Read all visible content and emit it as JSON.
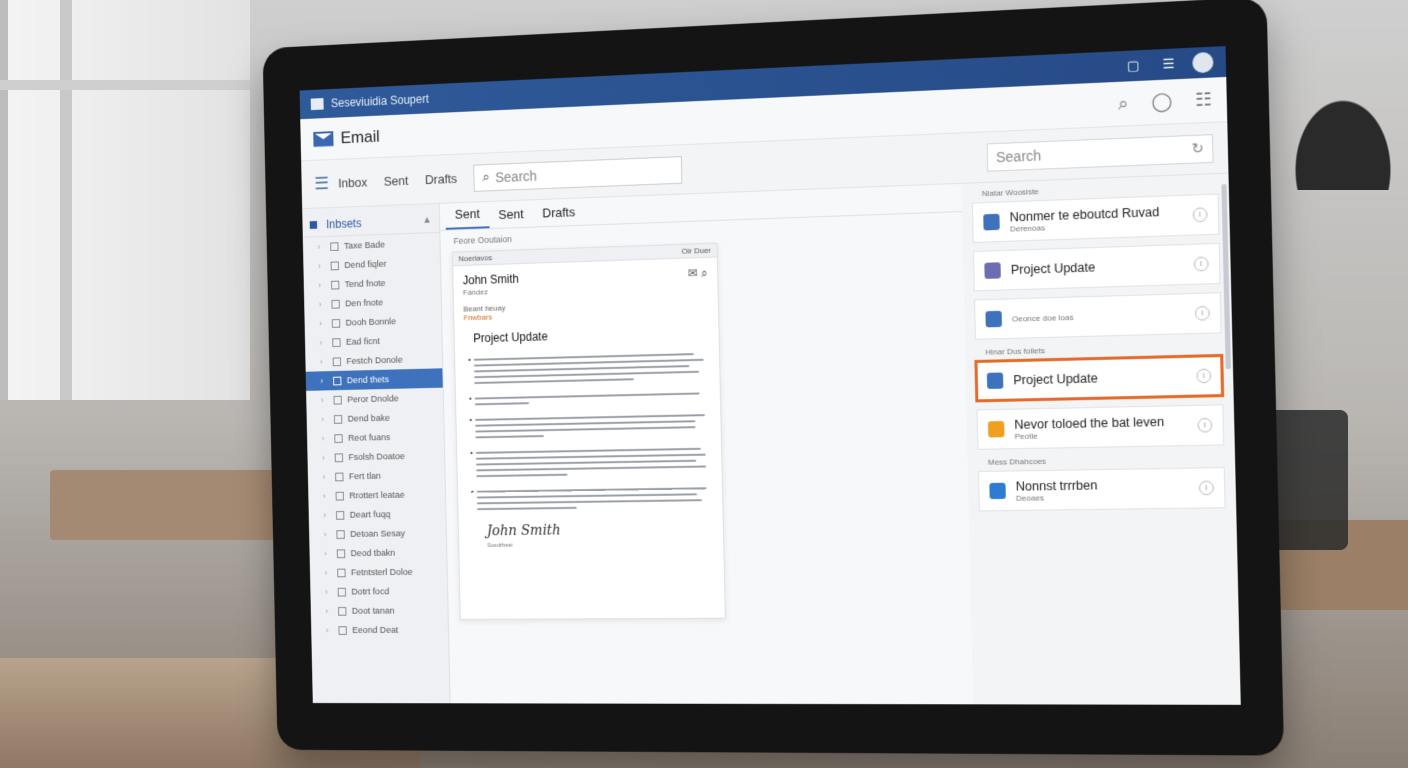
{
  "window": {
    "title": "Seseviuidia Soupert"
  },
  "app": {
    "title": "Email"
  },
  "toolbar": {
    "nav": [
      "Inbox",
      "Sent",
      "Drafts"
    ],
    "search_placeholder": "Search",
    "search2_placeholder": "Search"
  },
  "sidebar": {
    "header": "Inbsets",
    "items": [
      "Taxe Bade",
      "Dend fiqler",
      "Tend fnote",
      "Den fnote",
      "Dooh Bonnle",
      "Ead ficnt",
      "Festch Donole",
      "Dend thets",
      "Peror Dnolde",
      "Dend bake",
      "Reot fuans",
      "Fsolsh Doatoe",
      "Fert tlan",
      "Rrottert leatae",
      "Deart fuqq",
      "Detoan Sesay",
      "Deod tbakn",
      "Fetntsterl Doloe",
      "Dotrt focd",
      "Doot tanan",
      "Eeond Deat"
    ],
    "active_index": 7
  },
  "tabs": [
    "Sent",
    "Sent",
    "Drafts"
  ],
  "center": {
    "sublabel": "Feore Ooutaion",
    "message": {
      "topbar_left": "Noerlavos",
      "topbar_right": "Oir Duer",
      "from": "John Smith",
      "from_sub": "Fandez",
      "label1": "Beant heuay",
      "label2": "Fnwbars",
      "subject": "Project Update",
      "signature": "John Smith",
      "signature_sub": "Soedrbsai"
    }
  },
  "right": {
    "top_label": "Nlatar Woosiste",
    "cards": [
      {
        "title": "Nonmer te eboutcd Ruvad",
        "sub": "Derenoas",
        "icon_color": "#3e72bd"
      },
      {
        "title": "Project Update",
        "sub": "",
        "icon_color": "#6b6fb0"
      },
      {
        "title": "",
        "sub": "Oeonce doe loas",
        "icon_color": "#3e72bd"
      },
      {
        "title": "Project Update",
        "sub": "",
        "icon_color": "#3e72bd"
      },
      {
        "title": "Nevor toloed the bat leven",
        "sub": "Peotle",
        "icon_color": "#f0a020"
      },
      {
        "title": "Nonnst trrrben",
        "sub": "Deoaes",
        "icon_color": "#2f7bd2"
      }
    ],
    "mid_label1": "Hinar Dus follets",
    "mid_label2": "Mess Dhahcoes",
    "highlighted_index": 3
  }
}
